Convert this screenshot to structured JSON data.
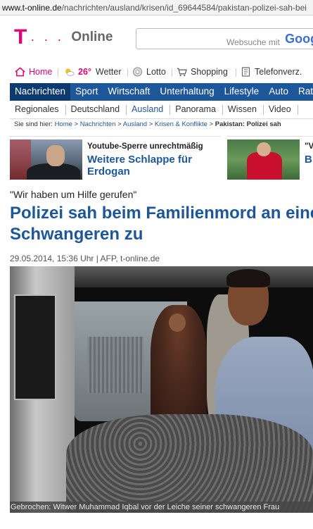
{
  "browser": {
    "url_host": "www.t-online.de",
    "url_path": "/nachrichten/ausland/krisen/id_69644584/pakistan-polizei-sah-bei"
  },
  "header": {
    "logo_letter": "T",
    "logo_dots": "· · ·",
    "logo_text": "Online",
    "search_placeholder": "Websuche mit",
    "search_engine": "Goog"
  },
  "utility": {
    "home": "Home",
    "temperature": "26°",
    "weather": "Wetter",
    "lotto": "Lotto",
    "shopping": "Shopping",
    "phone": "Telefonverz."
  },
  "main_nav": [
    "Nachrichten",
    "Sport",
    "Wirtschaft",
    "Unterhaltung",
    "Lifestyle",
    "Auto",
    "Ratgeber"
  ],
  "main_nav_active": "Nachrichten",
  "sub_nav": [
    "Regionales",
    "Deutschland",
    "Ausland",
    "Panorama",
    "Wissen",
    "Video"
  ],
  "sub_nav_active": "Ausland",
  "breadcrumb": {
    "prefix": "Sie sind hier:",
    "items": [
      "Home",
      "Nachrichten",
      "Ausland",
      "Krisen & Konflikte"
    ],
    "current": "Pakistan: Polizei sah"
  },
  "teasers": [
    {
      "kicker": "Youtube-Sperre unrechtmäßig",
      "title": "Weitere Schlappe für Erdogan"
    },
    {
      "kicker": "\"V",
      "title": "B"
    }
  ],
  "article": {
    "kicker": "\"Wir haben um Hilfe gerufen\"",
    "headline": "Polizei sah beim Familienmord an einer Schwangeren zu",
    "meta": "29.05.2014, 15:36 Uhr | AFP, t-online.de",
    "caption": "Gebrochen: Witwer Muhammad Iqbal vor der Leiche seiner schwangeren Frau"
  },
  "colors": {
    "brand_magenta": "#e20074",
    "nav_blue": "#1e5799",
    "headline_blue": "#1e5799"
  }
}
